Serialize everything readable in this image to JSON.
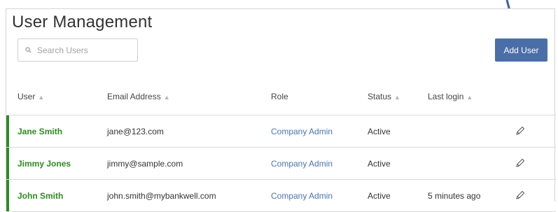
{
  "page": {
    "title": "User Management"
  },
  "search": {
    "placeholder": "Search Users"
  },
  "toolbar": {
    "add_user_label": "Add User"
  },
  "colors": {
    "accent_blue": "#4a6ea8",
    "active_green": "#2d8a1f",
    "role_link_blue": "#4a74b0",
    "annotation_arrow": "#3f5e9c"
  },
  "table": {
    "columns": [
      {
        "label": "User",
        "sortable": true
      },
      {
        "label": "Email Address",
        "sortable": true
      },
      {
        "label": "Role",
        "sortable": false
      },
      {
        "label": "Status",
        "sortable": true
      },
      {
        "label": "Last login",
        "sortable": true
      }
    ],
    "sort_indicator": "▲",
    "rows": [
      {
        "user": "Jane Smith",
        "email": "jane@123.com",
        "role": "Company Admin",
        "status": "Active",
        "last_login": ""
      },
      {
        "user": "Jimmy Jones",
        "email": "jimmy@sample.com",
        "role": "Company Admin",
        "status": "Active",
        "last_login": ""
      },
      {
        "user": "John Smith",
        "email": "john.smith@mybankwell.com",
        "role": "Company Admin",
        "status": "Active",
        "last_login": "5 minutes ago"
      }
    ]
  }
}
